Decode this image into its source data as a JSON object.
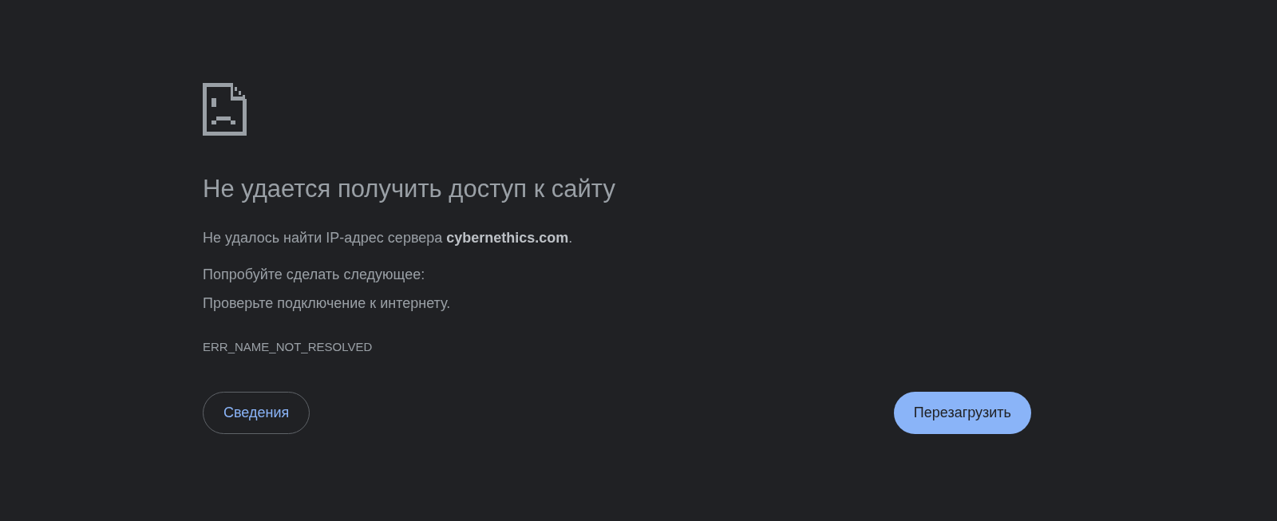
{
  "title": "Не удается получить доступ к сайту",
  "message": "Не удалось найти IP-адрес сервера **cybernethics.com**.",
  "suggestions_heading": "Попробуйте сделать следующее:",
  "suggestions": [
    "Проверьте подключение к интернету."
  ],
  "error_code": "ERR_NAME_NOT_RESOLVED",
  "buttons": [
    {
      "label": "Сведения",
      "kind": "secondary"
    },
    {
      "label": "Перезагрузить",
      "kind": "primary"
    }
  ]
}
